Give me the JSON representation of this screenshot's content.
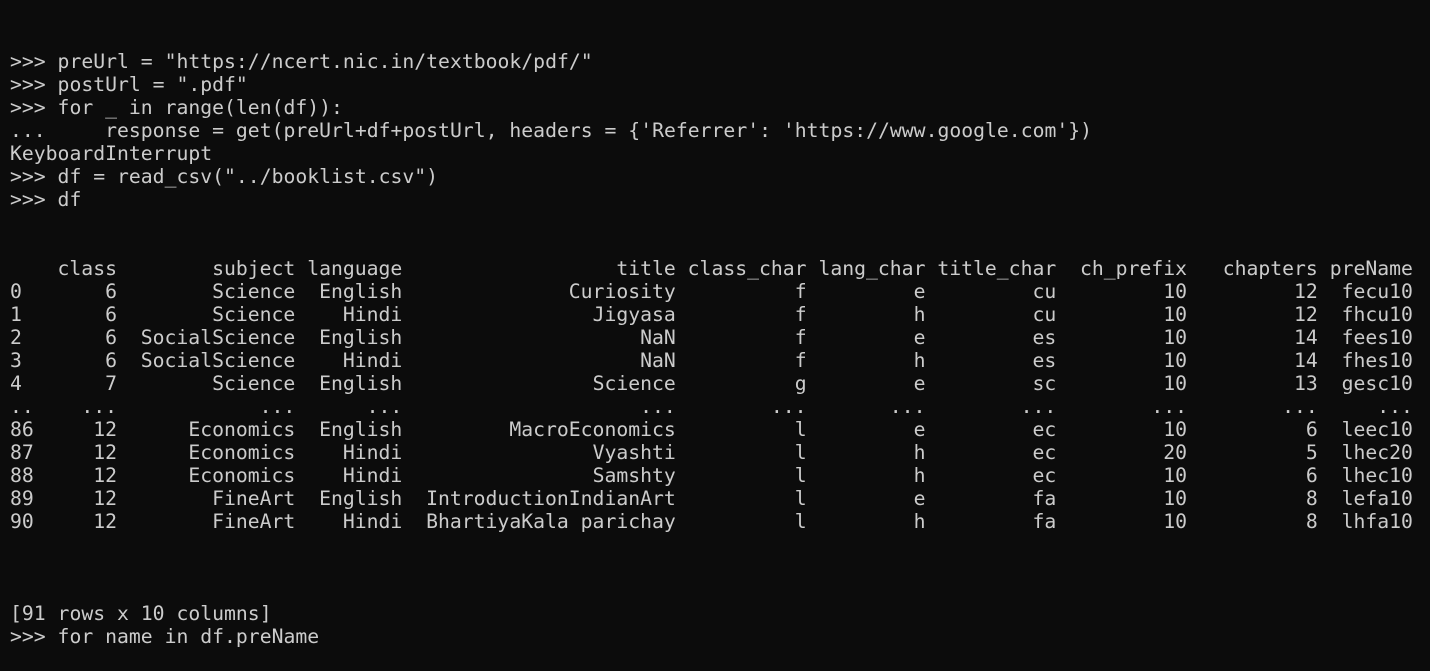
{
  "terminal": {
    "colors": {
      "background": "#0c0c0c",
      "text": "#cccccc"
    },
    "lines_before": [
      ">>> preUrl = \"https://ncert.nic.in/textbook/pdf/\"",
      ">>> postUrl = \".pdf\"",
      ">>> for _ in range(len(df)):",
      "...     response = get(preUrl+df+postUrl, headers = {'Referrer': 'https://www.google.com'})",
      "KeyboardInterrupt",
      ">>> df = read_csv(\"../booklist.csv\")",
      ">>> df"
    ],
    "table": {
      "columns": [
        "",
        "class",
        "subject",
        "language",
        "title",
        "class_char",
        "lang_char",
        "title_char",
        "ch_prefix",
        "chapters",
        "preName"
      ],
      "rows": [
        [
          "0",
          "6",
          "Science",
          "English",
          "Curiosity",
          "f",
          "e",
          "cu",
          "10",
          "12",
          "fecu10"
        ],
        [
          "1",
          "6",
          "Science",
          "Hindi",
          "Jigyasa",
          "f",
          "h",
          "cu",
          "10",
          "12",
          "fhcu10"
        ],
        [
          "2",
          "6",
          "SocialScience",
          "English",
          "NaN",
          "f",
          "e",
          "es",
          "10",
          "14",
          "fees10"
        ],
        [
          "3",
          "6",
          "SocialScience",
          "Hindi",
          "NaN",
          "f",
          "h",
          "es",
          "10",
          "14",
          "fhes10"
        ],
        [
          "4",
          "7",
          "Science",
          "English",
          "Science",
          "g",
          "e",
          "sc",
          "10",
          "13",
          "gesc10"
        ],
        [
          "..",
          "...",
          "...",
          "...",
          "...",
          "...",
          "...",
          "...",
          "...",
          "...",
          "..."
        ],
        [
          "86",
          "12",
          "Economics",
          "English",
          "MacroEconomics",
          "l",
          "e",
          "ec",
          "10",
          "6",
          "leec10"
        ],
        [
          "87",
          "12",
          "Economics",
          "Hindi",
          "Vyashti",
          "l",
          "h",
          "ec",
          "20",
          "5",
          "lhec20"
        ],
        [
          "88",
          "12",
          "Economics",
          "Hindi",
          "Samshty",
          "l",
          "h",
          "ec",
          "10",
          "6",
          "lhec10"
        ],
        [
          "89",
          "12",
          "FineArt",
          "English",
          "IntroductionIndianArt",
          "l",
          "e",
          "fa",
          "10",
          "8",
          "lefa10"
        ],
        [
          "90",
          "12",
          "FineArt",
          "Hindi",
          "BhartiyaKala parichay",
          "l",
          "h",
          "fa",
          "10",
          "8",
          "lhfa10"
        ]
      ]
    },
    "lines_after": [
      "",
      "[91 rows x 10 columns]",
      ">>> for name in df.preName"
    ]
  }
}
